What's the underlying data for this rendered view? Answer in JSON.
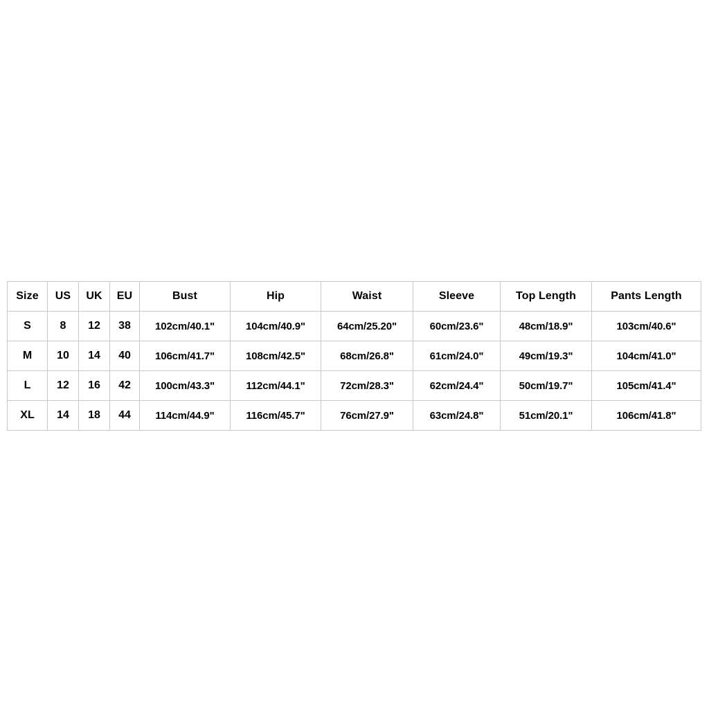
{
  "table": {
    "name": "size-chart",
    "columns": [
      "Size",
      "US",
      "UK",
      "EU",
      "Bust",
      "Hip",
      "Waist",
      "Sleeve",
      "Top Length",
      "Pants Length"
    ],
    "rows": [
      {
        "size": "S",
        "us": "8",
        "uk": "12",
        "eu": "38",
        "bust": "102cm/40.1\"",
        "hip": "104cm/40.9\"",
        "waist": "64cm/25.20\"",
        "sleeve": "60cm/23.6\"",
        "top_length": "48cm/18.9\"",
        "pants_length": "103cm/40.6\""
      },
      {
        "size": "M",
        "us": "10",
        "uk": "14",
        "eu": "40",
        "bust": "106cm/41.7\"",
        "hip": "108cm/42.5\"",
        "waist": "68cm/26.8\"",
        "sleeve": "61cm/24.0\"",
        "top_length": "49cm/19.3\"",
        "pants_length": "104cm/41.0\""
      },
      {
        "size": "L",
        "us": "12",
        "uk": "16",
        "eu": "42",
        "bust": "100cm/43.3\"",
        "hip": "112cm/44.1\"",
        "waist": "72cm/28.3\"",
        "sleeve": "62cm/24.4\"",
        "top_length": "50cm/19.7\"",
        "pants_length": "105cm/41.4\""
      },
      {
        "size": "XL",
        "us": "14",
        "uk": "18",
        "eu": "44",
        "bust": "114cm/44.9\"",
        "hip": "116cm/45.7\"",
        "waist": "76cm/27.9\"",
        "sleeve": "63cm/24.8\"",
        "top_length": "51cm/20.1\"",
        "pants_length": "106cm/41.8\""
      }
    ]
  },
  "colors": {
    "background": "#ffffff",
    "border": "#c9c9c9",
    "text": "#000000"
  }
}
